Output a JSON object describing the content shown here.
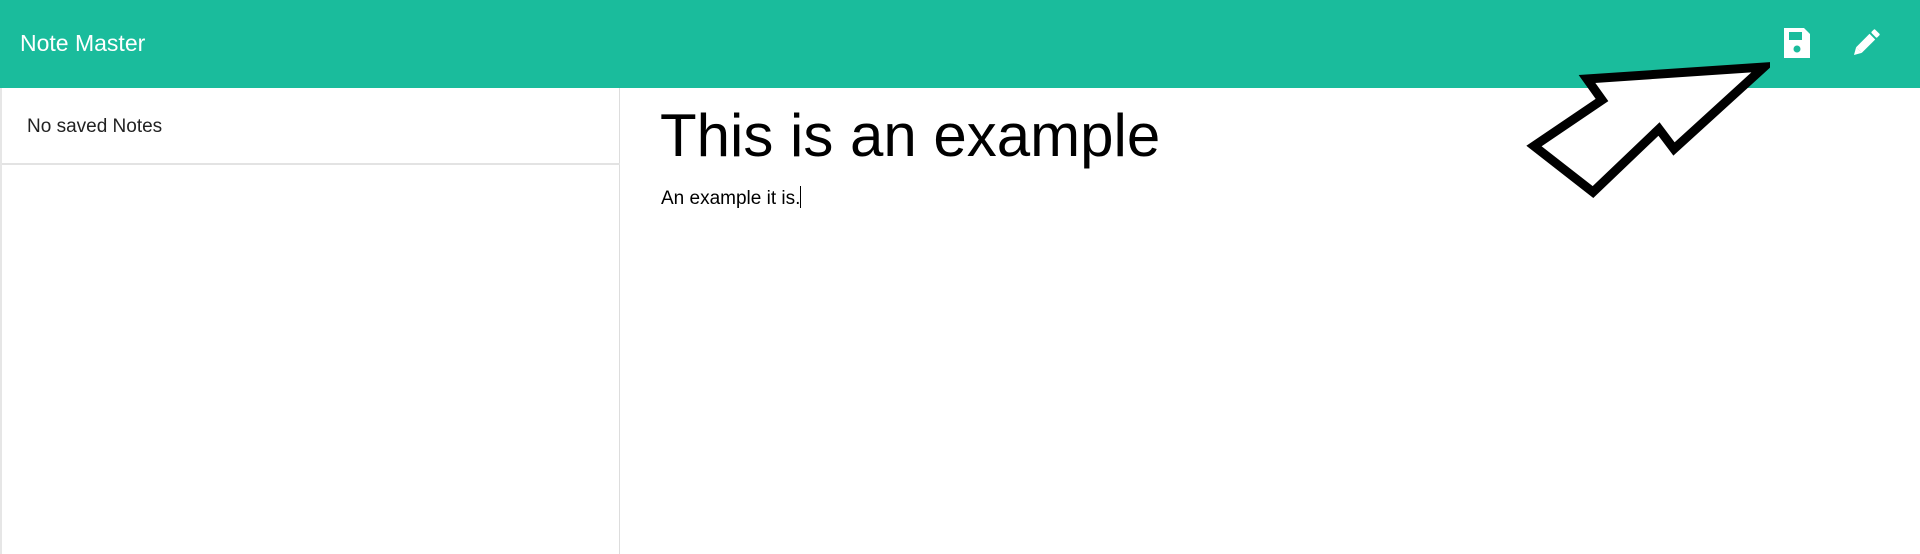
{
  "app": {
    "title": "Note Master"
  },
  "toolbar": {
    "save_icon": "save-icon",
    "edit_icon": "pencil-icon"
  },
  "sidebar": {
    "empty_message": "No saved Notes"
  },
  "note": {
    "title": "This is an example",
    "text": "An example it is."
  },
  "colors": {
    "navbar_bg": "#1abc9c",
    "navbar_text": "#ffffff"
  }
}
